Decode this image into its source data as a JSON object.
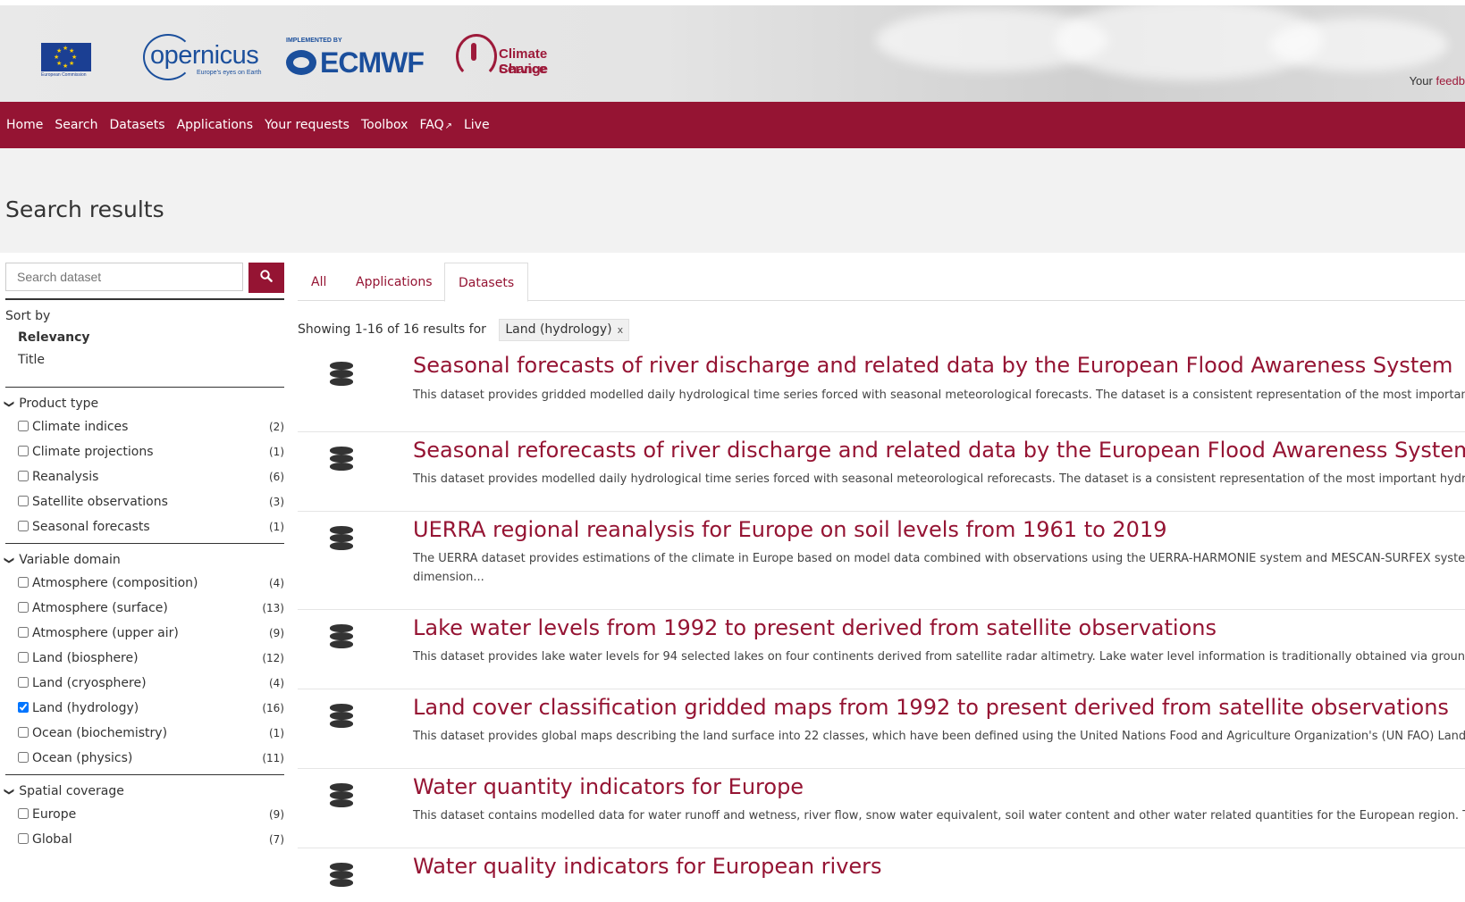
{
  "header": {
    "eu_text": "European Commission",
    "copernicus_word": "opernicus",
    "copernicus_tagline": "Europe's eyes on Earth",
    "ecmwf_implemented": "IMPLEMENTED BY",
    "ecmwf_name": "ECMWF",
    "c3s_line1": "Climate Change",
    "c3s_line2": "Service",
    "feedback_prefix": "Your ",
    "feedback_link": "feedb"
  },
  "nav": {
    "items": [
      "Home",
      "Search",
      "Datasets",
      "Applications",
      "Your requests",
      "Toolbox",
      "FAQ",
      "Live"
    ]
  },
  "page_title": "Search results",
  "search": {
    "placeholder": "Search dataset"
  },
  "sort": {
    "label": "Sort by",
    "options": [
      "Relevancy",
      "Title"
    ],
    "selected": "Relevancy"
  },
  "facets": {
    "product_type": {
      "title": "Product type",
      "items": [
        {
          "label": "Climate indices",
          "count": "(2)"
        },
        {
          "label": "Climate projections",
          "count": "(1)"
        },
        {
          "label": "Reanalysis",
          "count": "(6)"
        },
        {
          "label": "Satellite observations",
          "count": "(3)"
        },
        {
          "label": "Seasonal forecasts",
          "count": "(1)"
        }
      ]
    },
    "variable_domain": {
      "title": "Variable domain",
      "items": [
        {
          "label": "Atmosphere (composition)",
          "count": "(4)"
        },
        {
          "label": "Atmosphere (surface)",
          "count": "(13)"
        },
        {
          "label": "Atmosphere (upper air)",
          "count": "(9)"
        },
        {
          "label": "Land (biosphere)",
          "count": "(12)"
        },
        {
          "label": "Land (cryosphere)",
          "count": "(4)"
        },
        {
          "label": "Land (hydrology)",
          "count": "(16)"
        },
        {
          "label": "Ocean (biochemistry)",
          "count": "(1)"
        },
        {
          "label": "Ocean (physics)",
          "count": "(11)"
        }
      ]
    },
    "spatial_coverage": {
      "title": "Spatial coverage",
      "items": [
        {
          "label": "Europe",
          "count": "(9)"
        },
        {
          "label": "Global",
          "count": "(7)"
        }
      ]
    }
  },
  "tabs": [
    "All",
    "Applications",
    "Datasets"
  ],
  "active_tab": "Datasets",
  "showing_text": "Showing 1-16 of 16 results for",
  "filter_chip": {
    "label": "Land (hydrology)",
    "remove": "x"
  },
  "results": [
    {
      "title": "Seasonal forecasts of river discharge and related data by the European Flood Awareness System",
      "desc": [
        "This dataset provides gridded modelled daily hydrological time series forced with seasonal meteorological forecasts. The dataset is a consistent representation of the most importan"
      ]
    },
    {
      "title": "Seasonal reforecasts of river discharge and related data by the European Flood Awareness System",
      "desc": [
        "This dataset provides modelled daily hydrological time series forced with seasonal meteorological reforecasts. The dataset is a consistent representation of the most important hydro"
      ]
    },
    {
      "title": "UERRA regional reanalysis for Europe on soil levels from 1961 to 2019",
      "desc": [
        "The UERRA dataset provides estimations of the climate in Europe based on model data combined with observations using the UERRA-HARMONIE system and MESCAN-SURFEX system",
        "dimension..."
      ]
    },
    {
      "title": "Lake water levels from 1992 to present derived from satellite observations",
      "desc": [
        "This dataset provides lake water levels for 94 selected lakes on four continents derived from satellite radar altimetry. Lake water level information is traditionally obtained via ground"
      ]
    },
    {
      "title": "Land cover classification gridded maps from 1992 to present derived from satellite observations",
      "desc": [
        "This dataset provides global maps describing the land surface into 22 classes, which have been defined using the United Nations Food and Agriculture Organization's (UN FAO) Land"
      ]
    },
    {
      "title": "Water quantity indicators for Europe",
      "desc": [
        "This dataset contains modelled data for water runoff and wetness, river flow, snow water equivalent, soil water content and other water related quantities for the European region. T"
      ]
    },
    {
      "title": "Water quality indicators for European rivers",
      "desc": []
    }
  ],
  "colors": {
    "brand": "#951433",
    "nav_bg": "#951433",
    "title_band": "#f2f2f2"
  }
}
